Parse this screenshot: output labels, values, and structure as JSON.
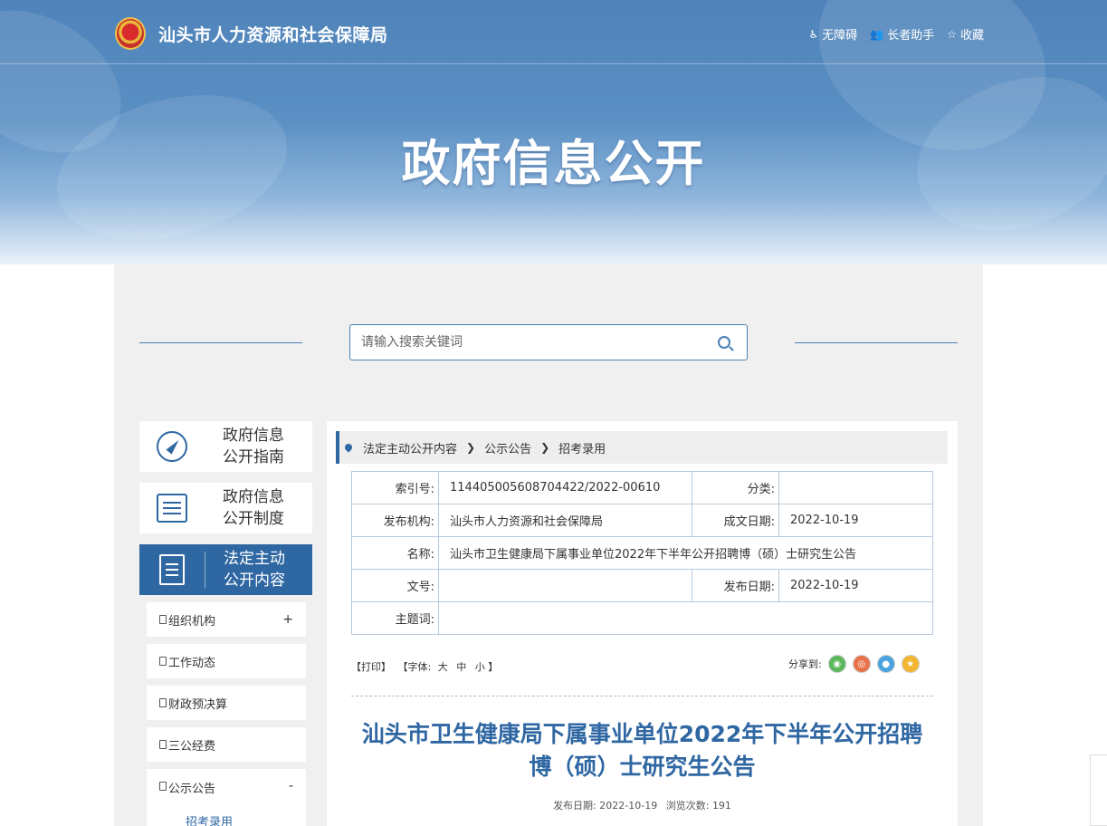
{
  "header": {
    "site_title": "汕头市人力资源和社会保障局",
    "links": [
      {
        "label": "无障碍",
        "icon": "accessibility-icon"
      },
      {
        "label": "长者助手",
        "icon": "elder-helper-icon"
      },
      {
        "label": "收藏",
        "icon": "star-icon"
      }
    ],
    "hero_title": "政府信息公开"
  },
  "search": {
    "placeholder": "请输入搜索关键词"
  },
  "sidebar": {
    "cards": [
      {
        "line1": "政府信息",
        "line2": "公开指南"
      },
      {
        "line1": "政府信息",
        "line2": "公开制度"
      },
      {
        "line1": "法定主动",
        "line2": "公开内容"
      }
    ],
    "items": [
      {
        "label": "组织机构",
        "toggle": "+"
      },
      {
        "label": "工作动态",
        "toggle": ""
      },
      {
        "label": "财政预决算",
        "toggle": ""
      },
      {
        "label": "三公经费",
        "toggle": ""
      },
      {
        "label": "公示公告",
        "toggle": "-"
      }
    ],
    "child": "招考录用"
  },
  "breadcrumb": [
    "法定主动公开内容",
    "公示公告",
    "招考录用"
  ],
  "meta": {
    "index_label": "索引号:",
    "index_value": "114405005608704422/2022-00610",
    "category_label": "分类:",
    "category_value": "",
    "org_label": "发布机构:",
    "org_value": "汕头市人力资源和社会保障局",
    "created_label": "成文日期:",
    "created_value": "2022-10-19",
    "name_label": "名称:",
    "name_value": "汕头市卫生健康局下属事业单位2022年下半年公开招聘博（硕）士研究生公告",
    "docno_label": "文号:",
    "docno_value": "",
    "published_label": "发布日期:",
    "published_value": "2022-10-19",
    "keywords_label": "主题词:",
    "keywords_value": ""
  },
  "tools": {
    "print": "【打印】",
    "font_prefix": "【字体:",
    "font_large": "大",
    "font_medium": "中",
    "font_small": "小",
    "font_suffix": "】",
    "share_label": "分享到:"
  },
  "share_colors": {
    "wechat": "#5bb85c",
    "weibo": "#e8734a",
    "qq": "#4aa3df",
    "qzone": "#f2b630"
  },
  "article": {
    "title_line1": "汕头市卫生健康局下属事业单位2022年下半年公开招聘",
    "title_line2": "博（硕）士研究生公告",
    "pub_date_label": "发布日期:",
    "pub_date": "2022-10-19",
    "views_label": "浏览次数:",
    "views": "191"
  }
}
